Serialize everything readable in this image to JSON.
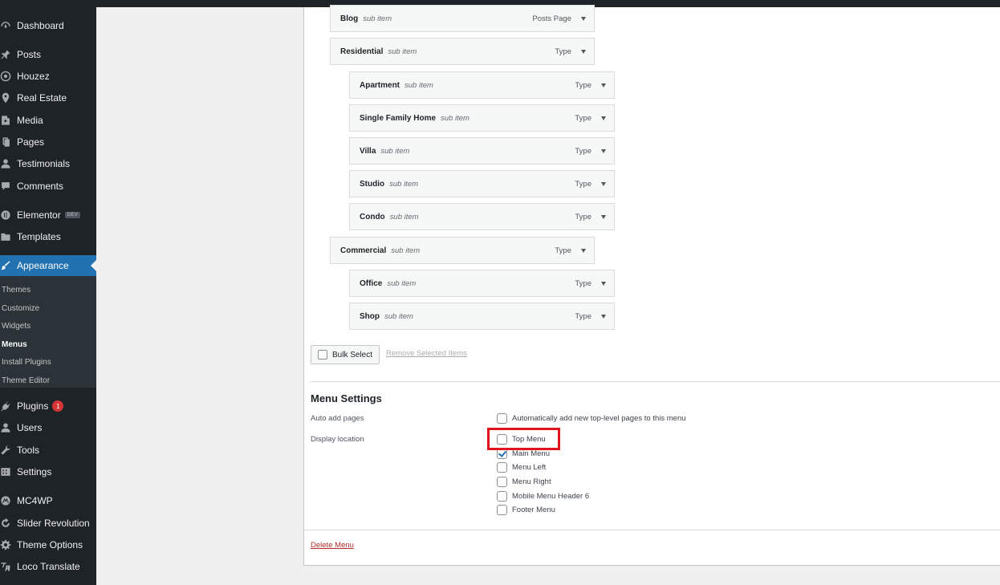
{
  "sidebar": {
    "items": [
      {
        "label": "Dashboard",
        "icon": "dashboard-icon"
      },
      {
        "label": "Posts",
        "icon": "pin-icon"
      },
      {
        "label": "Houzez",
        "icon": "houzez-icon"
      },
      {
        "label": "Real Estate",
        "icon": "location-icon"
      },
      {
        "label": "Media",
        "icon": "media-icon"
      },
      {
        "label": "Pages",
        "icon": "pages-icon"
      },
      {
        "label": "Testimonials",
        "icon": "user-icon"
      },
      {
        "label": "Comments",
        "icon": "comment-icon"
      },
      {
        "label": "Elementor",
        "icon": "elementor-icon",
        "badge": "DEV"
      },
      {
        "label": "Templates",
        "icon": "folder-icon"
      },
      {
        "label": "Appearance",
        "icon": "brush-icon"
      },
      {
        "label": "Plugins",
        "icon": "plugin-icon",
        "count": "1"
      },
      {
        "label": "Users",
        "icon": "users-icon"
      },
      {
        "label": "Tools",
        "icon": "wrench-icon"
      },
      {
        "label": "Settings",
        "icon": "settings-icon"
      },
      {
        "label": "MC4WP",
        "icon": "mc4wp-icon"
      },
      {
        "label": "Slider Revolution",
        "icon": "refresh-icon"
      },
      {
        "label": "Theme Options",
        "icon": "gear-icon"
      },
      {
        "label": "Loco Translate",
        "icon": "translate-icon"
      }
    ],
    "submenu": [
      "Themes",
      "Customize",
      "Widgets",
      "Menus",
      "Install Plugins",
      "Theme Editor"
    ]
  },
  "menu_structure": {
    "items": [
      {
        "title": "Blog",
        "subtitle": "sub item",
        "type": "Posts Page"
      },
      {
        "title": "Residential",
        "subtitle": "sub item",
        "type": "Type"
      },
      {
        "title": "Apartment",
        "subtitle": "sub item",
        "type": "Type"
      },
      {
        "title": "Single Family Home",
        "subtitle": "sub item",
        "type": "Type"
      },
      {
        "title": "Villa",
        "subtitle": "sub item",
        "type": "Type"
      },
      {
        "title": "Studio",
        "subtitle": "sub item",
        "type": "Type"
      },
      {
        "title": "Condo",
        "subtitle": "sub item",
        "type": "Type"
      },
      {
        "title": "Commercial",
        "subtitle": "sub item",
        "type": "Type"
      },
      {
        "title": "Office",
        "subtitle": "sub item",
        "type": "Type"
      },
      {
        "title": "Shop",
        "subtitle": "sub item",
        "type": "Type"
      }
    ],
    "bulk_select_label": "Bulk Select",
    "remove_selected_label": "Remove Selected Items"
  },
  "menu_settings": {
    "title": "Menu Settings",
    "auto_add_label": "Auto add pages",
    "auto_add_option": {
      "label": "Automatically add new top-level pages to this menu",
      "checked": false
    },
    "display_location_label": "Display location",
    "locations": [
      {
        "label": "Top Menu",
        "checked": false
      },
      {
        "label": "Main Menu",
        "checked": true
      },
      {
        "label": "Menu Left",
        "checked": false
      },
      {
        "label": "Menu Right",
        "checked": false
      },
      {
        "label": "Mobile Menu Header 6",
        "checked": false
      },
      {
        "label": "Footer Menu",
        "checked": false
      }
    ]
  },
  "delete_menu_label": "Delete Menu",
  "colors": {
    "sidebar_bg": "#1d2327",
    "accent": "#2271b1",
    "highlight_box": "#e0141a",
    "delete_link": "#b32d2e"
  }
}
